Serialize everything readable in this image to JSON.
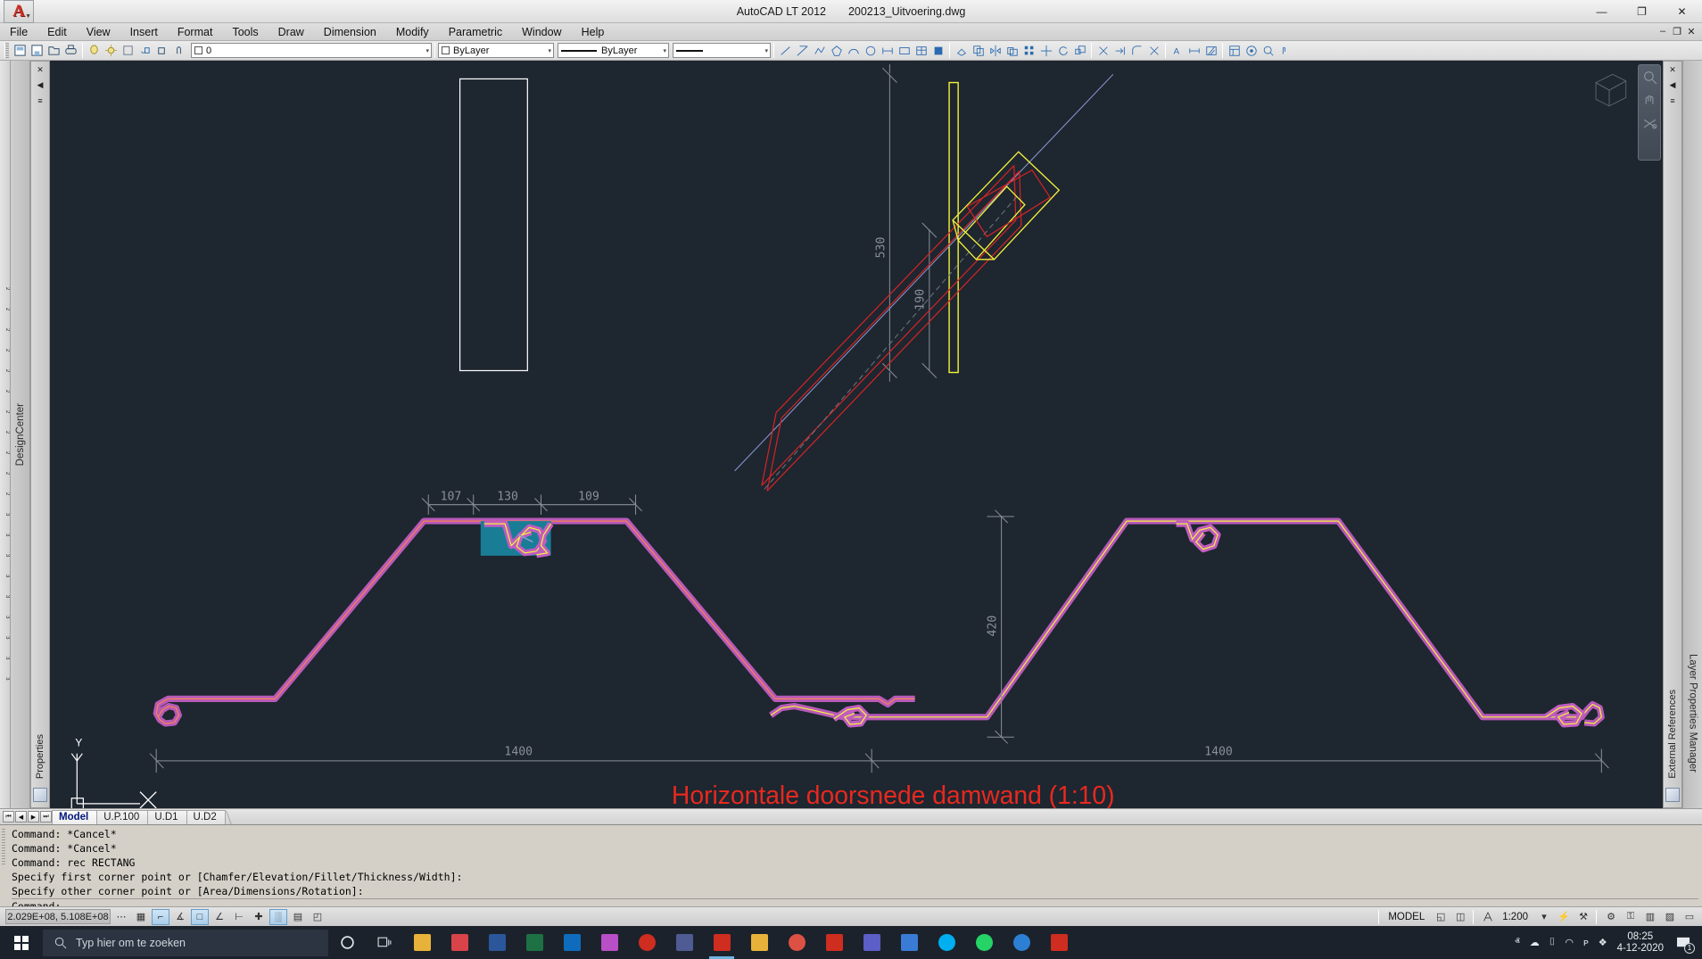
{
  "window": {
    "app_title": "AutoCAD LT 2012",
    "file_name": "200213_Uitvoering.dwg",
    "minimize": "—",
    "maximize": "❐",
    "close": "✕"
  },
  "menu": {
    "items": [
      {
        "label": "File"
      },
      {
        "label": "Edit"
      },
      {
        "label": "View"
      },
      {
        "label": "Insert"
      },
      {
        "label": "Format"
      },
      {
        "label": "Tools"
      },
      {
        "label": "Draw"
      },
      {
        "label": "Dimension"
      },
      {
        "label": "Modify"
      },
      {
        "label": "Parametric"
      },
      {
        "label": "Window"
      },
      {
        "label": "Help"
      }
    ],
    "doc_minimize": "–",
    "doc_restore": "❐",
    "doc_close": "✕"
  },
  "toolbar": {
    "layer_combo_value": "0",
    "color_combo_value": "ByLayer",
    "linetype_combo_value": "ByLayer",
    "lineweight_combo_value": "ByLayer",
    "dropdown_arrow": "▾"
  },
  "panels": {
    "left_ruler_label": "2",
    "designcenter_tab": "DesignCenter",
    "properties_palette_label": "Properties",
    "external_references_palette_label": "External References",
    "layer_properties_tab": "Layer Properties Manager",
    "close_icon": "✕",
    "autohide_icon": "◀",
    "menu_icon": "≡"
  },
  "drawing": {
    "title_text": "Horizontale doorsnede damwand (1:10)",
    "title_color": "#e8291e",
    "background_color": "#1e2630",
    "dimensions": {
      "top_detail": [
        {
          "label": "530",
          "value": 530
        },
        {
          "label": "190",
          "value": 190
        }
      ],
      "section_left": [
        {
          "label": "107",
          "value": 107
        },
        {
          "label": "130",
          "value": 130
        },
        {
          "label": "109",
          "value": 109
        }
      ],
      "section_height": {
        "label": "420",
        "value": 420
      },
      "overall": [
        {
          "label": "1400",
          "value": 1400
        },
        {
          "label": "1400",
          "value": 1400
        }
      ]
    },
    "colors": {
      "profile_magenta": "#c15cc1",
      "profile_yellow": "#f2f23a",
      "selection_cyan": "#1a7d96",
      "dimension_grey": "#8a8f96",
      "detail_red": "#d42424",
      "detail_blue": "#8a9bd6",
      "rect_white": "#ffffff"
    },
    "ucs_icon_labels": {
      "y": "Y",
      "x": "X"
    }
  },
  "layout_tabs": {
    "nav_first": "⏮",
    "nav_prev": "◀",
    "nav_next": "▶",
    "nav_last": "⏭",
    "tabs": [
      {
        "label": "Model",
        "active": true
      },
      {
        "label": "U.P.100",
        "active": false
      },
      {
        "label": "U.D1",
        "active": false
      },
      {
        "label": "U.D2",
        "active": false
      }
    ]
  },
  "command_line": {
    "history": [
      "Command: *Cancel*",
      "Command: *Cancel*",
      "Command: rec RECTANG",
      "Specify first corner point or [Chamfer/Elevation/Fillet/Thickness/Width]:",
      "Specify other corner point or [Area/Dimensions/Rotation]:"
    ],
    "prompt": "Command:"
  },
  "status_bar": {
    "coordinates": "2.029E+08, 5.108E+08",
    "space_label": "MODEL",
    "annotation_scale": "1:200",
    "scale_arrow": "▾",
    "toggles": [
      {
        "name": "infer-constraints",
        "on": false,
        "glyph": "⋯"
      },
      {
        "name": "grid-display",
        "on": false,
        "glyph": "▦"
      },
      {
        "name": "snap-mode",
        "on": true,
        "glyph": "⌐"
      },
      {
        "name": "ortho-mode",
        "on": false,
        "glyph": "∡"
      },
      {
        "name": "polar-tracking",
        "on": true,
        "glyph": "□"
      },
      {
        "name": "object-snap",
        "on": false,
        "glyph": "∠"
      },
      {
        "name": "osnap-tracking",
        "on": false,
        "glyph": "⊢"
      },
      {
        "name": "dynamic-ucs",
        "on": false,
        "glyph": "✚"
      },
      {
        "name": "dynamic-input",
        "on": true,
        "glyph": "░"
      },
      {
        "name": "lineweight",
        "on": false,
        "glyph": "▤"
      },
      {
        "name": "quick-properties",
        "on": false,
        "glyph": "◰"
      }
    ],
    "right_icons": [
      {
        "name": "model-space",
        "glyph": "◱"
      },
      {
        "name": "layout-space",
        "glyph": "◫"
      },
      {
        "name": "annotation-visibility",
        "glyph": "⚡"
      },
      {
        "name": "auto-scale",
        "glyph": "⚒"
      },
      {
        "name": "workspace-settings",
        "glyph": "⚙"
      },
      {
        "name": "toolbar-lock",
        "glyph": "⚿"
      },
      {
        "name": "hardware-accel",
        "glyph": "▥"
      },
      {
        "name": "isolate-objects",
        "glyph": "▨"
      },
      {
        "name": "clean-screen",
        "glyph": "▭"
      }
    ]
  },
  "taskbar": {
    "search_placeholder": "Typ hier om te zoeken",
    "time": "08:25",
    "date": "4-12-2020",
    "notification_count": "1",
    "apps": [
      {
        "name": "cortana",
        "color": "#1b222b"
      },
      {
        "name": "task-view",
        "color": "#1b222b"
      },
      {
        "name": "file-explorer-yellow",
        "color": "#e8b23a"
      },
      {
        "name": "store",
        "color": "#d8444a"
      },
      {
        "name": "word",
        "color": "#2b579a"
      },
      {
        "name": "excel",
        "color": "#1e7145"
      },
      {
        "name": "outlook",
        "color": "#0f6cbd"
      },
      {
        "name": "photos",
        "color": "#b84fc7"
      },
      {
        "name": "opera",
        "color": "#cf2d20"
      },
      {
        "name": "calculator",
        "color": "#4f5b93"
      },
      {
        "name": "autocad",
        "color": "#cf2d20",
        "active": true
      },
      {
        "name": "explorer-folder",
        "color": "#e8b23a"
      },
      {
        "name": "chrome",
        "color": "#dd5144"
      },
      {
        "name": "pdf-reader",
        "color": "#cf2d20"
      },
      {
        "name": "teams-purple",
        "color": "#5b5fc7"
      },
      {
        "name": "maps",
        "color": "#3a7bd5"
      },
      {
        "name": "skype",
        "color": "#00aff0"
      },
      {
        "name": "whatsapp",
        "color": "#25d366"
      },
      {
        "name": "edge",
        "color": "#2d7fd3"
      },
      {
        "name": "adobe",
        "color": "#cf2d20"
      }
    ],
    "tray_icons": [
      {
        "name": "show-hidden-icons",
        "glyph": "ⱏ"
      },
      {
        "name": "onedrive-icon",
        "glyph": "☁"
      },
      {
        "name": "battery-icon",
        "glyph": "⌷"
      },
      {
        "name": "wifi-icon",
        "glyph": "◠"
      },
      {
        "name": "volume-icon",
        "glyph": "ᴘ"
      },
      {
        "name": "dropbox-icon",
        "glyph": "❖"
      }
    ]
  }
}
